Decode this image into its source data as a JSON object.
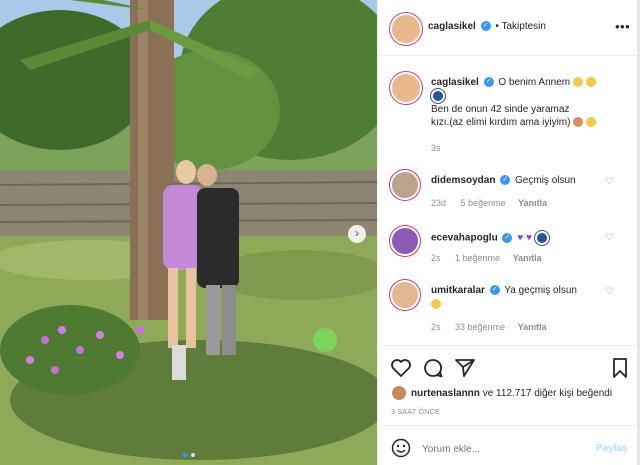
{
  "header": {
    "username": "caglasikel",
    "dot": "•",
    "follow_label": "Takiptesin",
    "more_icon": "ellipsis-icon"
  },
  "caption": {
    "username": "caglasikel",
    "line1": "O benim Annem",
    "line2": "Ben de onun 42 sinde yaramaz",
    "line3": "kızı.(az elimi kırdım ama iyiyim)",
    "time": "3s"
  },
  "comments": [
    {
      "user": "didemsoydan",
      "text": "Geçmiş olsun",
      "time": "23d",
      "likes": "5 beğenme",
      "reply": "Yanıtla"
    },
    {
      "user": "ecevahapoglu",
      "text": "",
      "time": "2s",
      "likes": "1 beğenme",
      "reply": "Yanıtla"
    },
    {
      "user": "umitkaralar",
      "text": "Ya geçmiş olsun",
      "time": "2s",
      "likes": "33 beğenme",
      "reply": "Yanıtla"
    }
  ],
  "actions": {
    "like_icon": "heart-icon",
    "comment_icon": "comment-icon",
    "share_icon": "send-icon",
    "save_icon": "bookmark-icon"
  },
  "likes_line": {
    "user": "nurtenaslannn",
    "rest": "ve 112.717 diğer kişi beğendi"
  },
  "timestamp": "3 SAAT ÖNCE",
  "composer": {
    "placeholder": "Yorum ekle...",
    "post_label": "Paylaş"
  },
  "colors": {
    "verified": "#3897f0",
    "post_button": "#b2dffc"
  }
}
